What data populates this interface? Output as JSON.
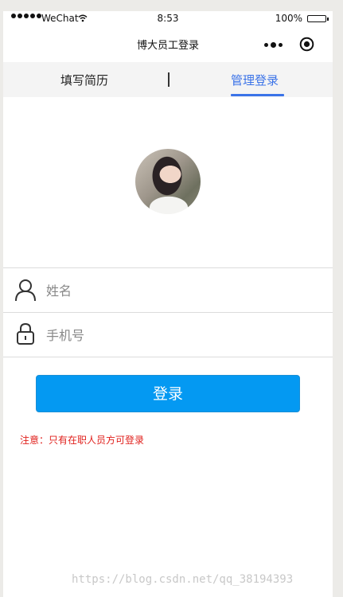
{
  "status_bar": {
    "carrier": "WeChat",
    "time": "8:53",
    "battery": "100%"
  },
  "navbar": {
    "title": "博大员工登录"
  },
  "tabs": {
    "resume": "填写简历",
    "separator": "|",
    "admin": "管理登录"
  },
  "form": {
    "name_placeholder": "姓名",
    "phone_placeholder": "手机号",
    "login_label": "登录",
    "notice": "注意：只有在职人员方可登录"
  },
  "watermark": "https://blog.csdn.net/qq_38194393",
  "colors": {
    "accent": "#3b73e8",
    "button": "#0499f2",
    "notice": "#e0201c"
  }
}
